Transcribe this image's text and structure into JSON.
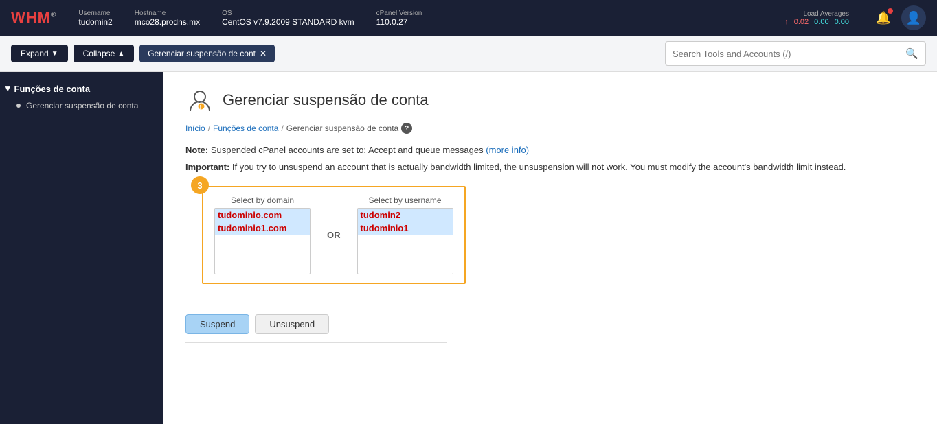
{
  "topbar": {
    "logo": "WHM",
    "username_label": "Username",
    "username_value": "tudomin2",
    "hostname_label": "Hostname",
    "hostname_value": "mco28.prodns.mx",
    "os_label": "OS",
    "os_value": "CentOS v7.9.2009 STANDARD kvm",
    "cpanel_label": "cPanel Version",
    "cpanel_value": "110.0.27",
    "load_label": "Load Averages",
    "load_up": "0.02",
    "load_1": "0.00",
    "load_2": "0.00"
  },
  "toolbar": {
    "expand_label": "Expand",
    "collapse_label": "Collapse",
    "tab_label": "Gerenciar suspensão de cont",
    "search_placeholder": "Search Tools and Accounts (/)"
  },
  "sidebar": {
    "section_label": "Funções de conta",
    "item_label": "Gerenciar suspensão de conta"
  },
  "breadcrumb": {
    "home": "Início",
    "section": "Funções de conta",
    "current": "Gerenciar suspensão de conta"
  },
  "page": {
    "title": "Gerenciar suspensão de conta",
    "note_label": "Note:",
    "note_text": "Suspended cPanel accounts are set to: Accept and queue messages",
    "note_link_text": "(more info)",
    "important_label": "Important:",
    "important_text": "If you try to unsuspend an account that is actually bandwidth limited, the unsuspension will not work. You must modify the account's bandwidth limit instead.",
    "step_number": "3",
    "select_domain_label": "Select by domain",
    "select_username_label": "Select by username",
    "or_text": "OR",
    "domain_options": [
      {
        "value": "tudominio.com",
        "label": "tudominio.com",
        "selected": true
      },
      {
        "value": "tudominio1.com",
        "label": "tudominio1.com",
        "selected": true
      }
    ],
    "username_options": [
      {
        "value": "tudomin2",
        "label": "tudomin2",
        "selected": true
      },
      {
        "value": "tudominio1",
        "label": "tudominio1",
        "selected": true
      }
    ],
    "suspend_btn": "Suspend",
    "unsuspend_btn": "Unsuspend"
  }
}
